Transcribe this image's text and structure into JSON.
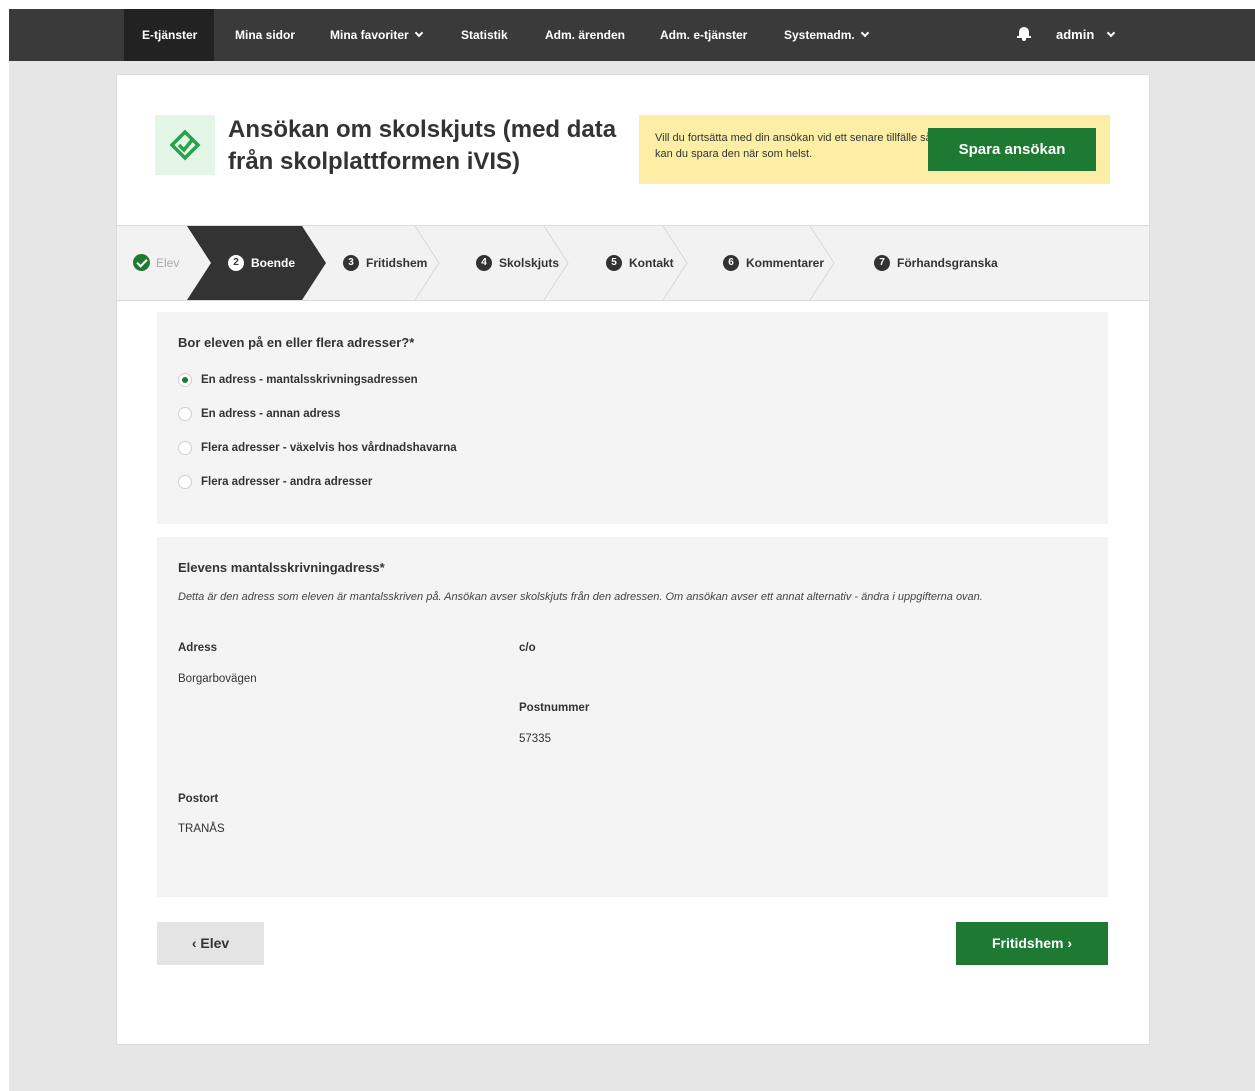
{
  "nav": {
    "items": [
      "E-tjänster",
      "Mina sidor",
      "Mina favoriter",
      "Statistik",
      "Adm. ärenden",
      "Adm. e-tjänster",
      "Systemadm."
    ],
    "user": "admin"
  },
  "header": {
    "title": "Ansökan om skolskjuts (med data från skolplattformen iVIS)",
    "save_text": "Vill du fortsätta med din ansökan vid ett senare tillfälle så kan du spara den när som helst.",
    "save_button": "Spara ansökan"
  },
  "steps": [
    {
      "num": "",
      "label": "Elev"
    },
    {
      "num": "2",
      "label": "Boende"
    },
    {
      "num": "3",
      "label": "Fritidshem"
    },
    {
      "num": "4",
      "label": "Skolskjuts"
    },
    {
      "num": "5",
      "label": "Kontakt"
    },
    {
      "num": "6",
      "label": "Kommentarer"
    },
    {
      "num": "7",
      "label": "Förhandsgranska"
    }
  ],
  "question": {
    "title": "Bor eleven på en eller flera adresser?*",
    "options": [
      "En adress - mantalsskrivningsadressen",
      "En adress - annan adress",
      "Flera adresser - växelvis hos vårdnadshavarna",
      "Flera adresser - andra adresser"
    ],
    "selected_index": 0
  },
  "address": {
    "title": "Elevens mantalsskrivningadress*",
    "description": "Detta är den adress som eleven är mantalsskriven på. Ansökan avser skolskjuts från den adressen. Om ansökan avser ett annat alternativ - ändra i uppgifterna ovan.",
    "address_label": "Adress",
    "address_value": "Borgarbovägen",
    "co_label": "c/o",
    "postnummer_label": "Postnummer",
    "postnummer_value": "57335",
    "postort_label": "Postort",
    "postort_value": "TRANÅS"
  },
  "buttons": {
    "prev": "‹ Elev",
    "next": "Fritidshem ›"
  },
  "colors": {
    "nav_bg": "#3a3a3a",
    "brand_green": "#1e7a33",
    "notice_yellow": "#fdeea5"
  }
}
